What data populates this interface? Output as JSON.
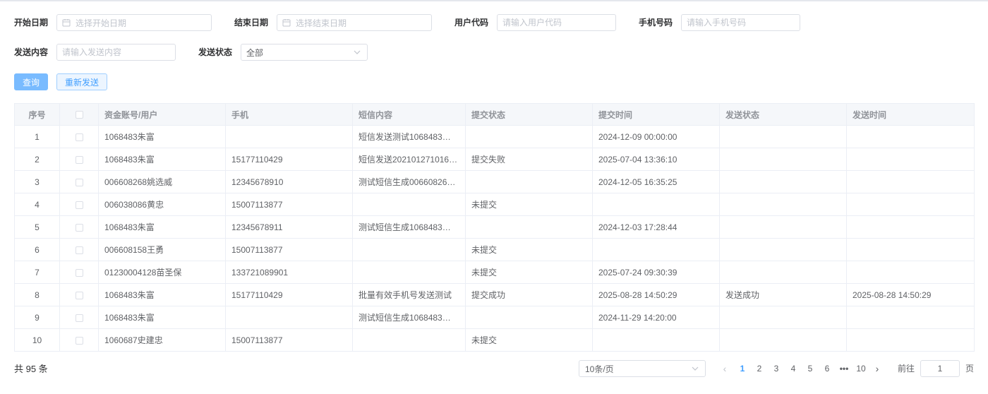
{
  "filters": {
    "start_date": {
      "label": "开始日期",
      "placeholder": "选择开始日期"
    },
    "end_date": {
      "label": "结束日期",
      "placeholder": "选择结束日期"
    },
    "user_code": {
      "label": "用户代码",
      "placeholder": "请输入用户代码"
    },
    "phone": {
      "label": "手机号码",
      "placeholder": "请输入手机号码"
    },
    "content": {
      "label": "发送内容",
      "placeholder": "请输入发送内容"
    },
    "send_status": {
      "label": "发送状态",
      "value": "全部"
    }
  },
  "buttons": {
    "query": "查询",
    "resend": "重新发送"
  },
  "table": {
    "headers": [
      "序号",
      "",
      "资金账号/用户",
      "手机",
      "短信内容",
      "提交状态",
      "提交时间",
      "发送状态",
      "发送时间"
    ],
    "rows": [
      [
        "1",
        "",
        "1068483朱富",
        "",
        "短信发送测试1068483…",
        "",
        "2024-12-09 00:00:00",
        "",
        ""
      ],
      [
        "2",
        "",
        "1068483朱富",
        "15177110429",
        "短信发送202101271016…",
        "提交失败",
        "2025-07-04 13:36:10",
        "",
        ""
      ],
      [
        "3",
        "",
        "006608268姚选威",
        "12345678910",
        "测试短信生成00660826…",
        "",
        "2024-12-05 16:35:25",
        "",
        ""
      ],
      [
        "4",
        "",
        "006038086黄忠",
        "15007113877",
        "",
        "未提交",
        "",
        "",
        ""
      ],
      [
        "5",
        "",
        "1068483朱富",
        "12345678911",
        "测试短信生成1068483…",
        "",
        "2024-12-03 17:28:44",
        "",
        ""
      ],
      [
        "6",
        "",
        "006608158王勇",
        "15007113877",
        "",
        "未提交",
        "",
        "",
        ""
      ],
      [
        "7",
        "",
        "01230004128苗圣保",
        "133721089901",
        "",
        "未提交",
        "2025-07-24 09:30:39",
        "",
        ""
      ],
      [
        "8",
        "",
        "1068483朱富",
        "15177110429",
        "批量有效手机号发送测试",
        "提交成功",
        "2025-08-28 14:50:29",
        "发送成功",
        "2025-08-28 14:50:29"
      ],
      [
        "9",
        "",
        "1068483朱富",
        "",
        "测试短信生成1068483…",
        "",
        "2024-11-29 14:20:00",
        "",
        ""
      ],
      [
        "10",
        "",
        "1060687史建忠",
        "15007113877",
        "",
        "未提交",
        "",
        "",
        ""
      ]
    ]
  },
  "pagination": {
    "total_text": "共 95 条",
    "page_size": "10条/页",
    "pages": [
      "1",
      "2",
      "3",
      "4",
      "5",
      "6",
      "•••",
      "10"
    ],
    "current": "1",
    "goto_label": "前往",
    "goto_value": "1",
    "goto_unit": "页",
    "prev_icon": "chevron-left-icon",
    "next_icon": "chevron-right-icon"
  },
  "colors": {
    "primary": "#409eff",
    "query_button": "#79bbff",
    "header_bg": "#f5f7fa",
    "border": "#ebeef5"
  }
}
